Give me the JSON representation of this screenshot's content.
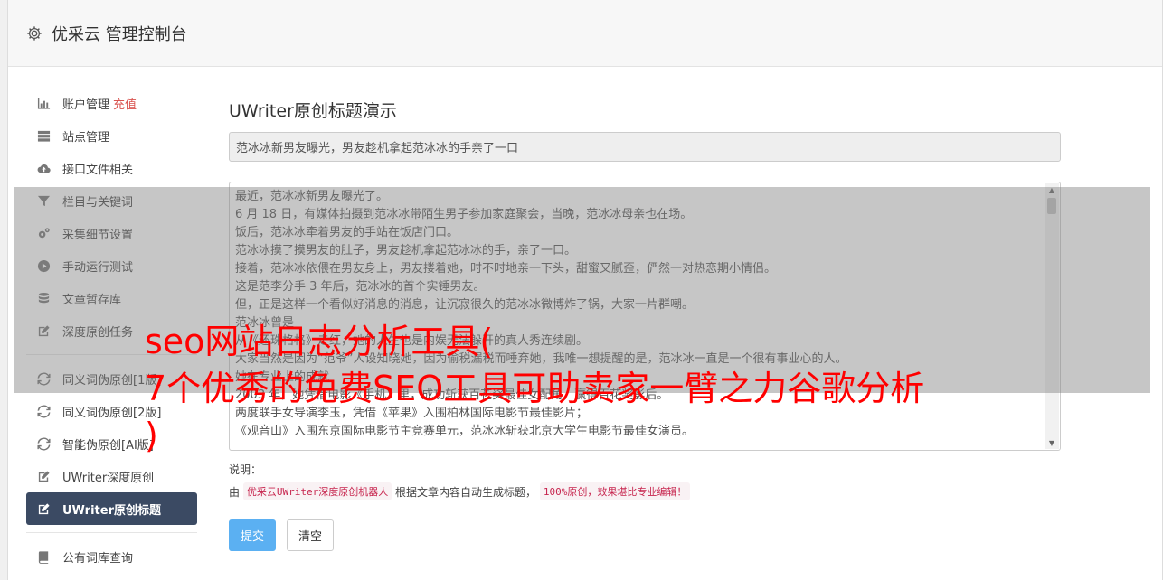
{
  "header": {
    "title": "优采云 管理控制台",
    "icon": "gear-icon"
  },
  "sidebar": {
    "group1": [
      {
        "label": "账户管理",
        "badge": "充值",
        "icon": "bar-chart-icon"
      },
      {
        "label": "站点管理",
        "icon": "server-icon"
      },
      {
        "label": "接口文件相关",
        "icon": "cloud-upload-icon"
      },
      {
        "label": "栏目与关键词",
        "icon": "filter-icon"
      },
      {
        "label": "采集细节设置",
        "icon": "cogs-icon"
      },
      {
        "label": "手动运行测试",
        "icon": "play-circle-icon"
      },
      {
        "label": "文章暂存库",
        "icon": "database-icon"
      },
      {
        "label": "深度原创任务",
        "icon": "edit-icon"
      }
    ],
    "group2": [
      {
        "label": "同义词伪原创[1版]",
        "icon": "refresh-icon"
      },
      {
        "label": "同义词伪原创[2版]",
        "icon": "refresh-icon"
      },
      {
        "label": "智能伪原创[AI版]",
        "icon": "refresh-icon"
      },
      {
        "label": "UWriter深度原创",
        "icon": "edit-icon"
      },
      {
        "label": "UWriter原创标题",
        "icon": "edit-icon",
        "active": true
      }
    ],
    "group3": [
      {
        "label": "公有词库查询",
        "icon": "book-icon"
      }
    ]
  },
  "main": {
    "heading": "UWriter原创标题演示",
    "title_value": "范冰冰新男友曝光，男友趁机拿起范冰冰的手亲了一口",
    "content_lines": [
      "最近，范冰冰新男友曝光了。",
      "6 月 18 日，有媒体拍摄到范冰冰带陌生男子参加家庭聚会，当晚，范冰冰母亲也在场。",
      "饭后，范冰冰牵着男友的手站在饭店门口。",
      "范冰冰摸了摸男友的肚子，男友趁机拿起范冰冰的手，亲了一口。",
      "接着，范冰冰依偎在男友身上，男友搂着她，时不时地亲一下头，甜蜜又腻歪，俨然一对热恋期小情侣。",
      "这是范李分手 3 年后，范冰冰的首个实锤男友。",
      "但，正是这样一个看似好消息的消息，让沉寂很久的范冰冰微博炸了锅，大家一片群嘲。",
      "范冰冰曾是",
      "从《还珠格格》走红，她的人生也是内娱无法躲开的真人秀连续剧。",
      "大家当然是因为“范爷”人设知晓她，因为偷税漏税而唾弃她，我唯一想提醒的是，范冰冰一直是一个很有事业心的人。",
      "她在专业上的成就",
      "2003 年，她凭借电影《手机》里，成功斩获百花奖最佳女配角，赢得百花奖影后。",
      "两度联手女导演李玉，凭借《苹果》入围柏林国际电影节最佳影片；",
      "《观音山》入围东京国际电影节主竞赛单元，范冰冰斩获北京大学生电影节最佳女演员。"
    ],
    "note_label": "说明：",
    "note_prefix": "由",
    "note_code1": "优采云UWriter深度原创机器人",
    "note_middle": "根据文章内容自动生成标题，",
    "note_code2": "100%原创，效果堪比专业编辑！",
    "submit_label": "提交",
    "clear_label": "清空"
  },
  "overlay": {
    "line1": "seo网站日志分析工具(",
    "line2": "7个优秀的免费SEO工具可助卖家一臂之力谷歌分析",
    "line3": ")"
  },
  "colors": {
    "active_nav": "#3b4a63",
    "primary_button": "#5bb0f2",
    "badge": "#d9534f",
    "overlay_text": "#ff0000"
  }
}
